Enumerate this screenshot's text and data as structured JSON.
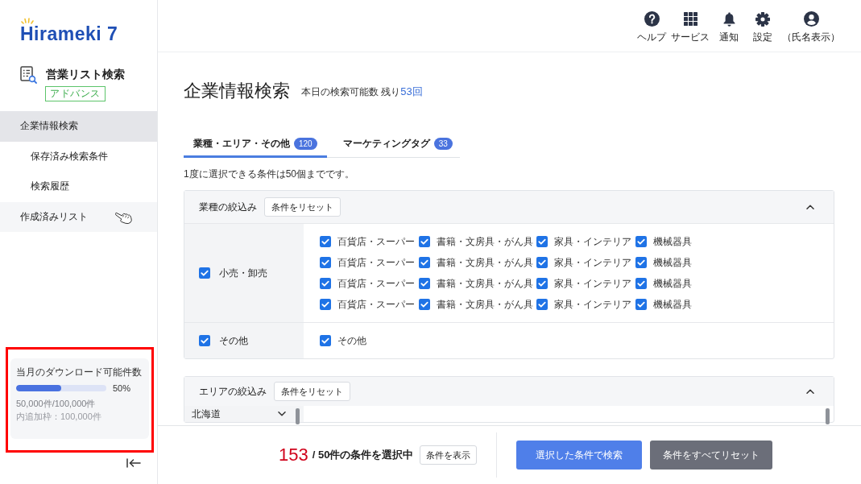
{
  "logo": {
    "text": "Hirameki 7"
  },
  "header_nav": [
    {
      "kind": "help",
      "label": "ヘルプ"
    },
    {
      "kind": "services",
      "label": "サービス"
    },
    {
      "kind": "notifications",
      "label": "通知"
    },
    {
      "kind": "settings",
      "label": "設定"
    },
    {
      "kind": "account",
      "label": "（氏名表示）"
    }
  ],
  "sidebar": {
    "service": {
      "title": "営業リスト検索",
      "badge": "アドバンス"
    },
    "items": [
      {
        "label": "企業情報検索",
        "selected": true,
        "hovered": false,
        "children": [
          {
            "label": "保存済み検索条件",
            "selected": false,
            "hovered": false
          },
          {
            "label": "検索履歴",
            "selected": false,
            "hovered": false
          }
        ]
      },
      {
        "label": "作成済みリスト",
        "selected": false,
        "hovered": true
      }
    ],
    "download_card": {
      "title": "当月のダウンロード可能件数",
      "level": 0.5,
      "percent": "50%",
      "count": "50,000件/100,000件",
      "extra": "内追加枠：100,000件"
    }
  },
  "page": {
    "title": "企業情報検索",
    "quota_label": "本日の検索可能数",
    "remaining_prefix": "残り",
    "remaining_value": "53回"
  },
  "tabs": [
    {
      "label": "業種・エリア・その他",
      "count": "120",
      "selected": true
    },
    {
      "label": "マーケティングタグ",
      "count": "33",
      "selected": false
    }
  ],
  "note": "1度に選択できる条件は50個までです。",
  "industry_filter": {
    "title": "業種の絞込み",
    "reset_label": "条件をリセット",
    "expanded": true,
    "categories": [
      {
        "label": "小売・卸売",
        "checked": true,
        "options": [
          {
            "label": "百貨店・スーパー",
            "checked": true
          },
          {
            "label": "書籍・文房具・がん具",
            "checked": true
          },
          {
            "label": "家具・インテリア",
            "checked": true
          },
          {
            "label": "機械器具",
            "checked": true
          },
          {
            "label": "百貨店・スーパー",
            "checked": true
          },
          {
            "label": "書籍・文房具・がん具",
            "checked": true
          },
          {
            "label": "家具・インテリア",
            "checked": true
          },
          {
            "label": "機械器具",
            "checked": true
          },
          {
            "label": "百貨店・スーパー",
            "checked": true
          },
          {
            "label": "書籍・文房具・がん具",
            "checked": true
          },
          {
            "label": "家具・インテリア",
            "checked": true
          },
          {
            "label": "機械器具",
            "checked": true
          },
          {
            "label": "百貨店・スーパー",
            "checked": true
          },
          {
            "label": "書籍・文房具・がん具",
            "checked": true
          },
          {
            "label": "家具・インテリア",
            "checked": true
          },
          {
            "label": "機械器具",
            "checked": true
          }
        ]
      },
      {
        "label": "その他",
        "checked": true,
        "options": [
          {
            "label": "その他",
            "checked": true
          }
        ]
      }
    ]
  },
  "area_filter": {
    "title": "エリアの絞込み",
    "reset_label": "条件をリセット",
    "expanded": true,
    "regions": [
      {
        "label": "北海道",
        "expanded": false
      }
    ]
  },
  "footer": {
    "selected_count": "153",
    "over_limit": true,
    "limit_text": "/ 50件の条件を選択中",
    "show_label": "条件を表示",
    "search_label": "選択した条件で検索",
    "reset_all_label": "条件をすべてリセット"
  }
}
